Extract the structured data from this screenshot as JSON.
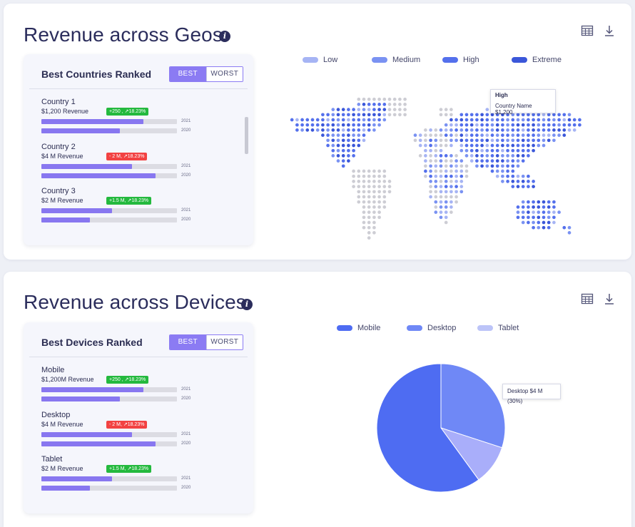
{
  "geo": {
    "title": "Revenue across Geos",
    "panel_title": "Best Countries Ranked",
    "toggle": {
      "best": "BEST",
      "worst": "WORST"
    },
    "items": [
      {
        "name": "Country 1",
        "revenue": "$1,200 Revenue",
        "badge": "+250 , ↗18.23%",
        "trend": "up",
        "bar_2021": 0.75,
        "bar_2020": 0.58,
        "year_a": "2021",
        "year_b": "2020"
      },
      {
        "name": "Country 2",
        "revenue": "$4 M Revenue",
        "badge": "- 2 M, ↗18.23%",
        "trend": "down",
        "bar_2021": 0.67,
        "bar_2020": 0.84,
        "year_a": "2021",
        "year_b": "2020"
      },
      {
        "name": "Country 3",
        "revenue": "$2 M Revenue",
        "badge": "+1.5 M, ↗18.23%",
        "trend": "up",
        "bar_2021": 0.52,
        "bar_2020": 0.36,
        "year_a": "2021",
        "year_b": "2020"
      }
    ],
    "legend": [
      {
        "label": "Low",
        "color": "#a6b4f4"
      },
      {
        "label": "Medium",
        "color": "#7a92f2"
      },
      {
        "label": "High",
        "color": "#5470ec"
      },
      {
        "label": "Extreme",
        "color": "#3b57d9"
      }
    ],
    "tooltip": {
      "title": "High",
      "text": "Country Name $1,200"
    }
  },
  "devices": {
    "title": "Revenue across Devices",
    "panel_title": "Best Devices Ranked",
    "toggle": {
      "best": "BEST",
      "worst": "WORST"
    },
    "items": [
      {
        "name": "Mobile",
        "revenue": "$1,200M Revenue",
        "badge": "+250 , ↗18.23%",
        "trend": "up",
        "bar_2021": 0.75,
        "bar_2020": 0.58,
        "year_a": "2021",
        "year_b": "2020"
      },
      {
        "name": "Desktop",
        "revenue": "$4 M Revenue",
        "badge": "- 2 M, ↗18.23%",
        "trend": "down",
        "bar_2021": 0.67,
        "bar_2020": 0.84,
        "year_a": "2021",
        "year_b": "2020"
      },
      {
        "name": "Tablet",
        "revenue": "$2 M Revenue",
        "badge": "+1.5 M, ↗18.23%",
        "trend": "up",
        "bar_2021": 0.52,
        "bar_2020": 0.36,
        "year_a": "2021",
        "year_b": "2020"
      }
    ],
    "legend": [
      {
        "label": "Mobile",
        "color": "#4e6cf2"
      },
      {
        "label": "Desktop",
        "color": "#6f88f6"
      },
      {
        "label": "Tablet",
        "color": "#bcc4f8"
      }
    ],
    "tooltip": {
      "text": "Desktop $4 M (30%)"
    }
  },
  "icons": {
    "table": "table-icon",
    "download": "download-icon",
    "info": "info-icon"
  },
  "info_glyph": "i",
  "chart_data": {
    "type": "pie",
    "labels": [
      "Mobile",
      "Desktop",
      "Tablet"
    ],
    "values": [
      60,
      30,
      10
    ],
    "colors": [
      "#4e6cf2",
      "#6f88f6",
      "#a9aefa"
    ]
  }
}
